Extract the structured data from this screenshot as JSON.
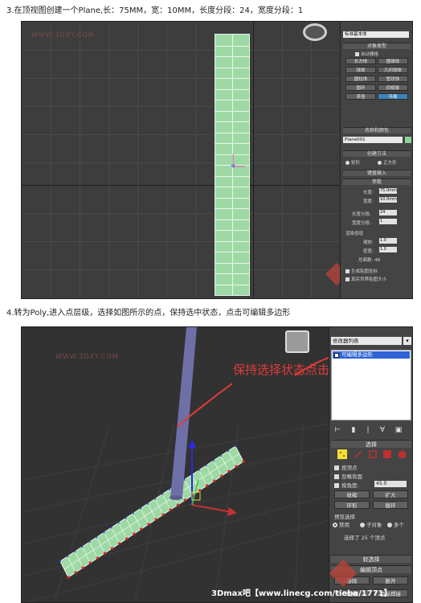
{
  "step3": {
    "caption": "3.在顶视图创建一个Plane,长：75MM，宽：10MM，长度分段：24，宽度分段：1",
    "watermark": "WWW.3DXY.COM",
    "panel": {
      "dropdown": "标准基本体",
      "section_object_type": "对象类型",
      "autogrid": "自动栅格",
      "buttons": [
        "长方体",
        "圆锥体",
        "球体",
        "几何球体",
        "圆柱体",
        "管状体",
        "圆环",
        "四棱锥",
        "茶壶",
        "平面"
      ],
      "active_button": "平面",
      "section_name_color": "名称和颜色",
      "object_name": "Plane001",
      "section_creation_method": "创建方法",
      "method_rect": "矩形",
      "method_square": "正方形",
      "section_keyboard": "键盘输入",
      "section_params": "参数",
      "length_label": "长度:",
      "length_value": "75.0mm",
      "width_label": "宽度:",
      "width_value": "10.0mm",
      "length_segs_label": "长度分段:",
      "length_segs_value": "24",
      "width_segs_label": "宽度分段:",
      "width_segs_value": "1",
      "render_multipliers": "渲染倍增",
      "scale_label": "缩放:",
      "scale_value": "1.0",
      "density_label": "密度:",
      "density_value": "1.0",
      "total_faces": "总面数: 48",
      "gen_mapping": "生成贴图坐标",
      "real_world": "真实世界贴图大小"
    }
  },
  "step4": {
    "caption": "4.转为Poly,进入点层级，选择如图所示的点，保持选中状态，点击可编辑多边形",
    "watermark": "WWW.3DXY.COM",
    "annotation": "保持选择状态点击",
    "footer": "3Dmax吧【www.linecg.com/tieba/1771】",
    "panel": {
      "dropdown": "修改器列表",
      "stack_item": "可编辑多边形",
      "section_select": "选择",
      "by_vertex": "按顶点",
      "ignore_backfacing": "忽略背面",
      "by_angle": "按角度:",
      "angle_value": "45.0",
      "shrink": "收缩",
      "grow": "扩大",
      "ring": "环形",
      "loop": "循环",
      "preview_selection": "预览选择",
      "preview_off": "禁用",
      "preview_subobj": "子对象",
      "preview_multi": "多个",
      "selected_count": "选择了 25 个顶点",
      "section_soft": "软选择",
      "section_edit_vertices": "编辑顶点",
      "remove": "移除",
      "break": "断开",
      "weld": "切角",
      "target_weld": "目标焊接"
    }
  }
}
